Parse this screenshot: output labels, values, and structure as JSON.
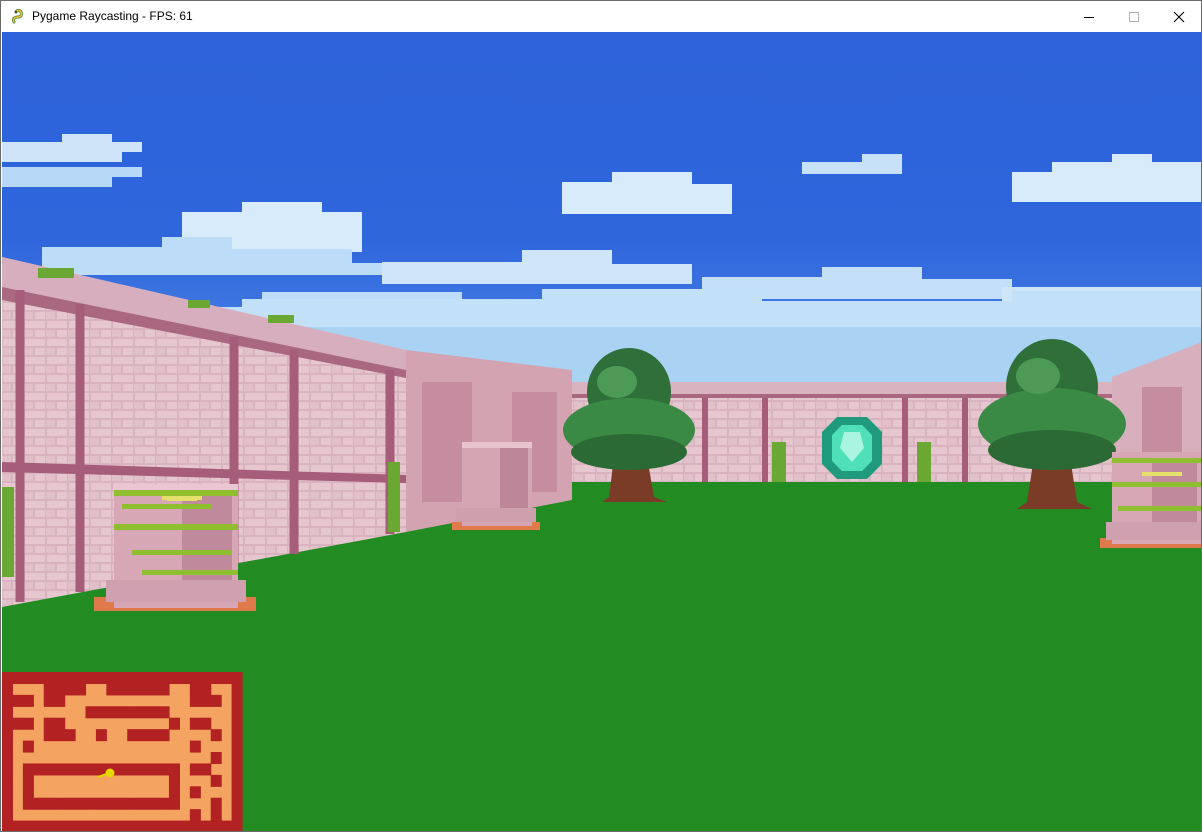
{
  "window": {
    "title": "Pygame Raycasting - FPS: 61",
    "icon": "pygame-snake-icon",
    "controls": [
      "minimize-icon",
      "maximize-icon",
      "close-icon"
    ]
  },
  "scene": {
    "colors": {
      "sky": "#2a5fd8",
      "sky_haze": "#9cc8f0",
      "floor": "#228b22",
      "wall": "#c99aa8",
      "wall_trim": "#a05a78",
      "minimap_wall": "#b22222",
      "minimap_floor": "#f4a460",
      "player": "#e6d800"
    },
    "sprites": [
      "vine-stone-pillar",
      "stone-pillar",
      "tree",
      "emerald-gem",
      "tree",
      "vine-stone-pillar"
    ]
  },
  "minimap": {
    "rows": [
      "11111111111111111111111",
      "10001111001111110011001",
      "11101100000000000011101",
      "10000000111111110000001",
      "11101100000000001011001",
      "10001110010011110000101",
      "10100000000000000010001",
      "10000000000000000000101",
      "10111111111111111011001",
      "10100000000000001000101",
      "10100000000000001010001",
      "10111111111111111000101",
      "10000000000000000010101",
      "11111111111111111111111"
    ]
  }
}
